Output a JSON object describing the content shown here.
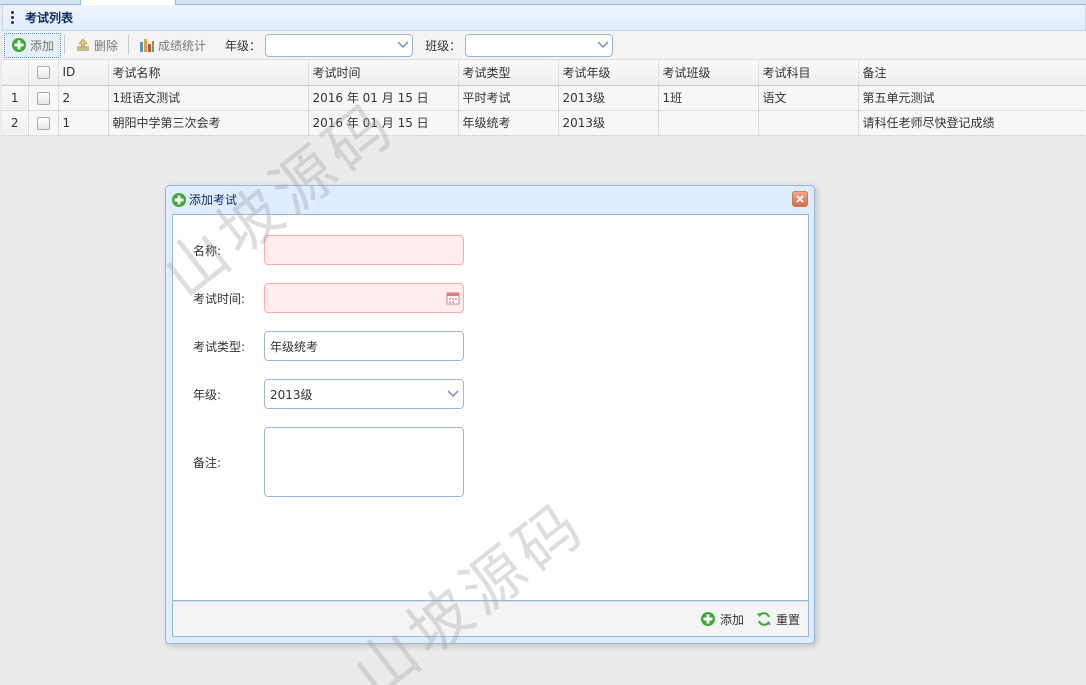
{
  "panel": {
    "title": "考试列表"
  },
  "toolbar": {
    "add_label": "添加",
    "delete_label": "删除",
    "stats_label": "成绩统计",
    "grade_label": "年级：",
    "grade_value": "",
    "class_label": "班级：",
    "class_value": ""
  },
  "grid": {
    "columns": [
      "ID",
      "考试名称",
      "考试时间",
      "考试类型",
      "考试年级",
      "考试班级",
      "考试科目",
      "备注"
    ],
    "rows": [
      {
        "rownum": "1",
        "id": "2",
        "name": "1班语文测试",
        "time": "2016 年 01 月 15 日",
        "type": "平时考试",
        "grade": "2013级",
        "class": "1班",
        "subject": "语文",
        "remark": "第五单元测试"
      },
      {
        "rownum": "2",
        "id": "1",
        "name": "朝阳中学第三次会考",
        "time": "2016 年 01 月 15 日",
        "type": "年级统考",
        "grade": "2013级",
        "class": "",
        "subject": "",
        "remark": "请科任老师尽快登记成绩"
      }
    ]
  },
  "dialog": {
    "title": "添加考试",
    "fields": {
      "name_label": "名称:",
      "name_value": "",
      "time_label": "考试时间:",
      "time_value": "",
      "type_label": "考试类型:",
      "type_value": "年级统考",
      "grade_label": "年级:",
      "grade_value": "2013级",
      "remark_label": "备注:",
      "remark_value": ""
    },
    "add_button": "添加",
    "reset_button": "重置"
  },
  "watermark": "山坡源码",
  "colors": {
    "accent": "#95b8e7",
    "header": "#e0ecff",
    "invalid": "#ffeded",
    "add_green": "#3aa832"
  }
}
